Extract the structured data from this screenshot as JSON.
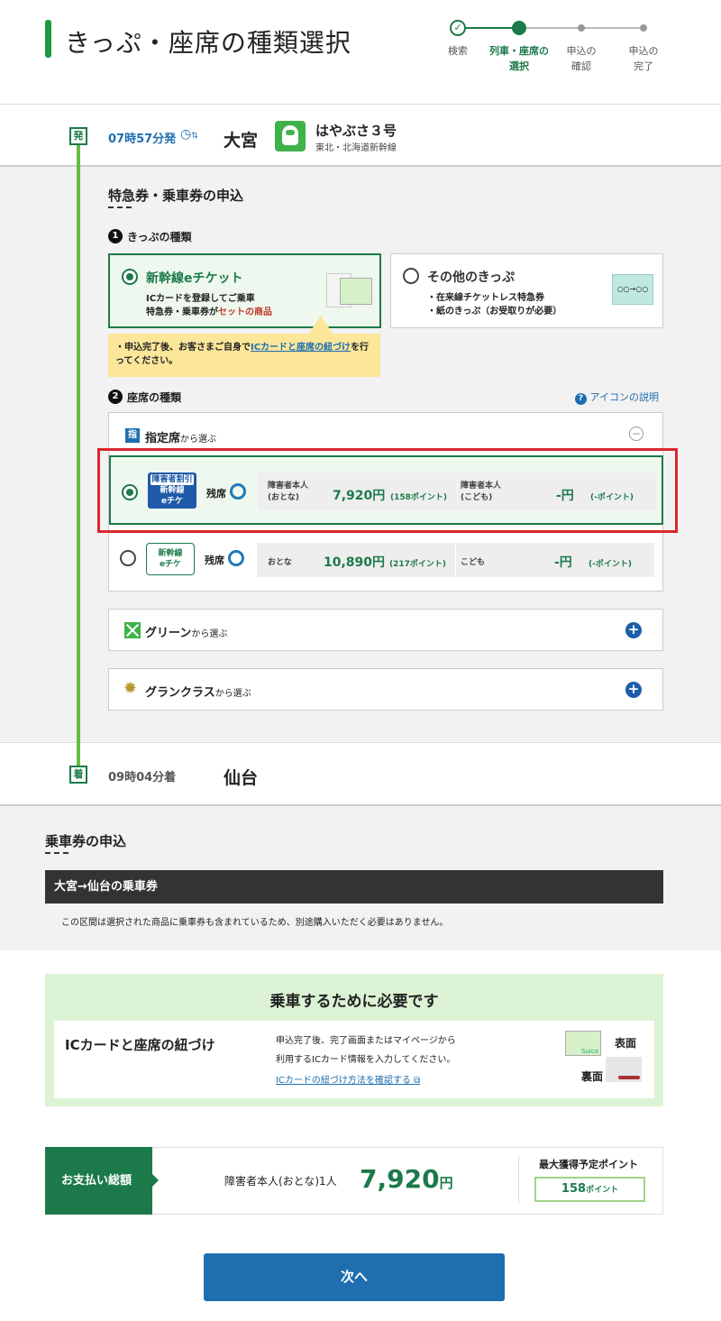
{
  "header": {
    "title": "きっぷ・座席の種類選択",
    "steps": [
      {
        "label1": "検索",
        "label2": ""
      },
      {
        "label1": "列車・座席の",
        "label2": "選択"
      },
      {
        "label1": "申込の",
        "label2": "確認"
      },
      {
        "label1": "申込の",
        "label2": "完了"
      }
    ]
  },
  "train": {
    "dep_tag": "発",
    "dep_time": "07時57分発",
    "dep_station": "大宮",
    "name": "はやぶさ３号",
    "line": "東北・北海道新幹線",
    "arr_tag": "着",
    "arr_time": "09時04分着",
    "arr_station": "仙台"
  },
  "express": {
    "heading": "特急券・乗車券の申込",
    "q1_num": "1",
    "q1_label": "きっぷの種類",
    "opt1_title": "新幹線eチケット",
    "opt1_line1": "ICカードを登録してご乗車",
    "opt1_line2a": "特急券・乗車券が",
    "opt1_line2b": "セットの商品",
    "opt2_title": "その他のきっぷ",
    "opt2_line1": "・在来線チケットレス特急券",
    "opt2_line2": "・紙のきっぷ（お受取りが必要）",
    "opt2_img": "○○→○○",
    "note_pre": "・申込完了後、お客さまご自身で",
    "note_link": "ICカードと座席の紐づけ",
    "note_post": "を行",
    "note_line2": "ってください。",
    "q2_num": "2",
    "q2_label": "座席の種類",
    "icon_help": "アイコンの説明",
    "reserved_badge": "指",
    "reserved_title": "指定席",
    "reserved_suffix": "から選ぶ",
    "minus": "−",
    "row1": {
      "badge1": "障害者割引",
      "badge2": "新幹線",
      "badge3": "eチケ",
      "remain": "残席",
      "adult_label1": "障害者本人",
      "adult_label2": "(おとな)",
      "adult_price": "7,920円",
      "adult_points": "(158ポイント)",
      "child_label1": "障害者本人",
      "child_label2": "(こども)",
      "child_price": "-円",
      "child_points": "(-ポイント)"
    },
    "row2": {
      "badge1": "新幹線",
      "badge2": "eチケ",
      "remain": "残席",
      "adult_label": "おとな",
      "adult_price": "10,890円",
      "adult_points": "(217ポイント)",
      "child_label": "こども",
      "child_price": "-円",
      "child_points": "(-ポイント)"
    },
    "green_title": "グリーン",
    "green_suffix": "から選ぶ",
    "gran_title": "グランクラス",
    "gran_suffix": "から選ぶ",
    "plus": "+"
  },
  "fare": {
    "heading": "乗車券の申込",
    "route": "大宮→仙台の乗車券",
    "note": "この区間は選択された商品に乗車券も含まれているため、別途購入いただく必要はありません。"
  },
  "required": {
    "heading": "乗車するために必要です",
    "title": "ICカードと座席の紐づけ",
    "line1": "申込完了後、完了画面またはマイページから",
    "line2": "利用するICカード情報を入力してください。",
    "link": "ICカードの紐づけ方法を確認する",
    "front": "表面",
    "back": "裏面",
    "card_text": "Suica"
  },
  "total": {
    "label": "お支払い総額",
    "who": "障害者本人(おとな)1人",
    "amount": "7,920",
    "yen": "円",
    "points_label": "最大獲得予定ポイント",
    "points_value": "158",
    "points_unit": "ポイント"
  },
  "next_button": "次へ",
  "colors": {
    "brand_green": "#1c7a4a",
    "accent_blue": "#1e6eb0",
    "highlight_red": "#d9272e",
    "note_yellow": "#fbe69a"
  }
}
